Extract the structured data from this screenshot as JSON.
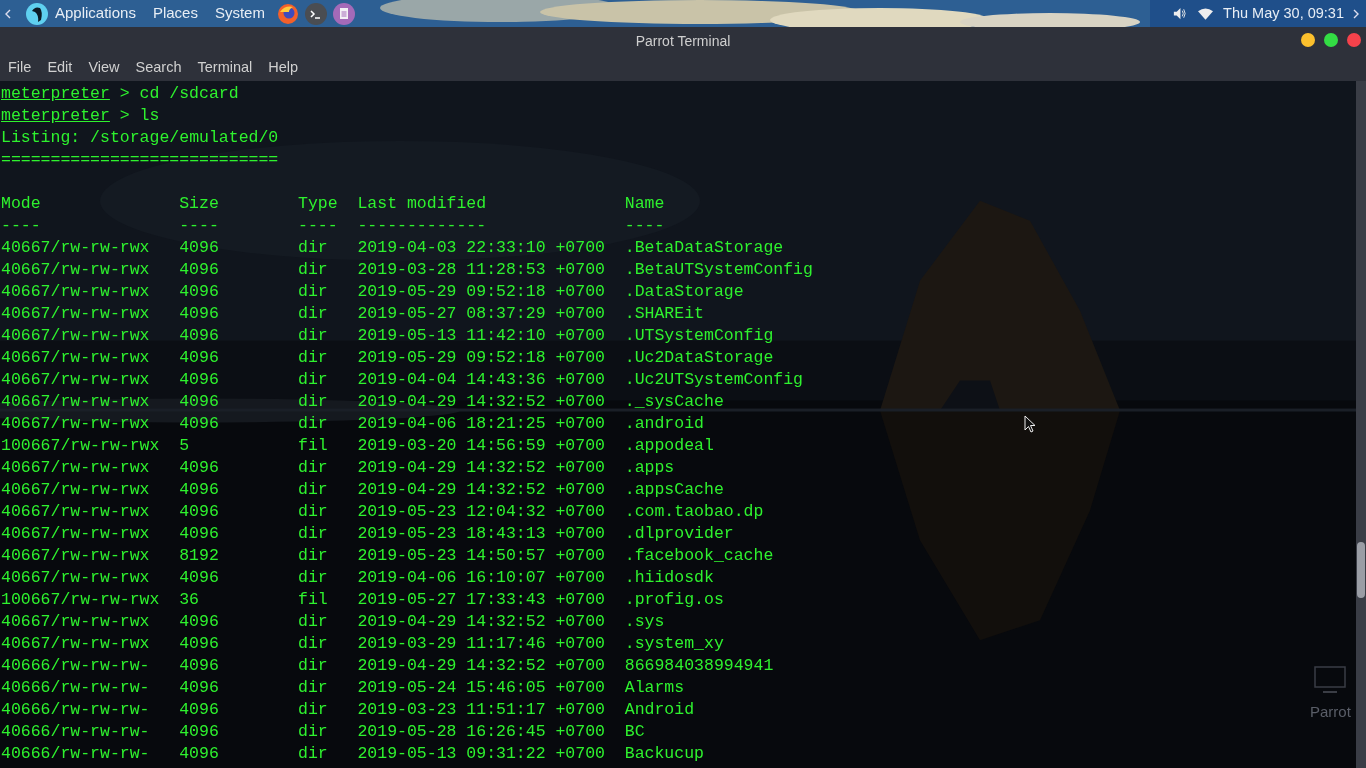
{
  "top_panel": {
    "menus": [
      "Applications",
      "Places",
      "System"
    ],
    "clock": "Thu May 30, 09:31"
  },
  "window": {
    "title": "Parrot Terminal",
    "menu": [
      "File",
      "Edit",
      "View",
      "Search",
      "Terminal",
      "Help"
    ]
  },
  "terminal": {
    "lines": [
      {
        "kind": "prompt",
        "prompt": "meterpreter",
        "command": "> cd /sdcard"
      },
      {
        "kind": "prompt",
        "prompt": "meterpreter",
        "command": "> ls"
      },
      {
        "kind": "output",
        "text": "Listing: /storage/emulated/0"
      },
      {
        "kind": "output",
        "text": "============================"
      },
      {
        "kind": "blank"
      }
    ],
    "listing": {
      "columns": [
        {
          "header": "Mode",
          "rule": "----"
        },
        {
          "header": "Size",
          "rule": "----"
        },
        {
          "header": "Type",
          "rule": "----"
        },
        {
          "header": "Last modified",
          "rule": "-------------"
        },
        {
          "header": "Name",
          "rule": "----"
        }
      ],
      "rows": [
        [
          "40667/rw-rw-rwx",
          "4096",
          "dir",
          "2019-04-03 22:33:10 +0700",
          ".BetaDataStorage"
        ],
        [
          "40667/rw-rw-rwx",
          "4096",
          "dir",
          "2019-03-28 11:28:53 +0700",
          ".BetaUTSystemConfig"
        ],
        [
          "40667/rw-rw-rwx",
          "4096",
          "dir",
          "2019-05-29 09:52:18 +0700",
          ".DataStorage"
        ],
        [
          "40667/rw-rw-rwx",
          "4096",
          "dir",
          "2019-05-27 08:37:29 +0700",
          ".SHAREit"
        ],
        [
          "40667/rw-rw-rwx",
          "4096",
          "dir",
          "2019-05-13 11:42:10 +0700",
          ".UTSystemConfig"
        ],
        [
          "40667/rw-rw-rwx",
          "4096",
          "dir",
          "2019-05-29 09:52:18 +0700",
          ".Uc2DataStorage"
        ],
        [
          "40667/rw-rw-rwx",
          "4096",
          "dir",
          "2019-04-04 14:43:36 +0700",
          ".Uc2UTSystemConfig"
        ],
        [
          "40667/rw-rw-rwx",
          "4096",
          "dir",
          "2019-04-29 14:32:52 +0700",
          "._sysCache"
        ],
        [
          "40667/rw-rw-rwx",
          "4096",
          "dir",
          "2019-04-06 18:21:25 +0700",
          ".android"
        ],
        [
          "100667/rw-rw-rwx",
          "5",
          "fil",
          "2019-03-20 14:56:59 +0700",
          ".appodeal"
        ],
        [
          "40667/rw-rw-rwx",
          "4096",
          "dir",
          "2019-04-29 14:32:52 +0700",
          ".apps"
        ],
        [
          "40667/rw-rw-rwx",
          "4096",
          "dir",
          "2019-04-29 14:32:52 +0700",
          ".appsCache"
        ],
        [
          "40667/rw-rw-rwx",
          "4096",
          "dir",
          "2019-05-23 12:04:32 +0700",
          ".com.taobao.dp"
        ],
        [
          "40667/rw-rw-rwx",
          "4096",
          "dir",
          "2019-05-23 18:43:13 +0700",
          ".dlprovider"
        ],
        [
          "40667/rw-rw-rwx",
          "8192",
          "dir",
          "2019-05-23 14:50:57 +0700",
          ".facebook_cache"
        ],
        [
          "40667/rw-rw-rwx",
          "4096",
          "dir",
          "2019-04-06 16:10:07 +0700",
          ".hiidosdk"
        ],
        [
          "100667/rw-rw-rwx",
          "36",
          "fil",
          "2019-05-27 17:33:43 +0700",
          ".profig.os"
        ],
        [
          "40667/rw-rw-rwx",
          "4096",
          "dir",
          "2019-04-29 14:32:52 +0700",
          ".sys"
        ],
        [
          "40667/rw-rw-rwx",
          "4096",
          "dir",
          "2019-03-29 11:17:46 +0700",
          ".system_xy"
        ],
        [
          "40666/rw-rw-rw-",
          "4096",
          "dir",
          "2019-04-29 14:32:52 +0700",
          "866984038994941"
        ],
        [
          "40666/rw-rw-rw-",
          "4096",
          "dir",
          "2019-05-24 15:46:05 +0700",
          "Alarms"
        ],
        [
          "40666/rw-rw-rw-",
          "4096",
          "dir",
          "2019-03-23 11:51:17 +0700",
          "Android"
        ],
        [
          "40666/rw-rw-rw-",
          "4096",
          "dir",
          "2019-05-28 16:26:45 +0700",
          "BC"
        ],
        [
          "40666/rw-rw-rw-",
          "4096",
          "dir",
          "2019-05-13 09:31:22 +0700",
          "Backucup"
        ]
      ]
    }
  },
  "desktop_icon": {
    "label": "Parrot"
  }
}
